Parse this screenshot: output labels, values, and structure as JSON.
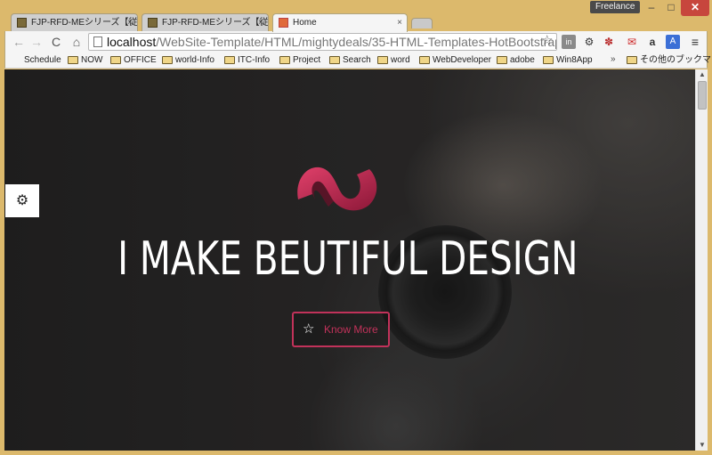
{
  "window": {
    "profile_label": "Freelance",
    "minimize_glyph": "–",
    "maximize_glyph": "□",
    "close_glyph": "✕"
  },
  "tabs": [
    {
      "title": "FJP-RFD-MEシリーズ【従来",
      "close": "×"
    },
    {
      "title": "FJP-RFD-MEシリーズ【従来",
      "close": "×"
    },
    {
      "title": "Home",
      "close": "×"
    }
  ],
  "toolbar": {
    "back_glyph": "←",
    "forward_glyph": "→",
    "reload_glyph": "C",
    "home_glyph": "⌂",
    "url_host": "localhost",
    "url_path": "/WebSite-Template/HTML/mightydeals/35-HTML-Templates-HotBootstrap.",
    "star_glyph": "☆",
    "extensions": [
      {
        "icon": "ext-in-icon",
        "glyph": "in"
      },
      {
        "icon": "gear-icon",
        "glyph": "⚙"
      },
      {
        "icon": "puzzle-icon",
        "glyph": "✽"
      },
      {
        "icon": "translate-icon",
        "glyph": "✉"
      },
      {
        "icon": "amazon-icon",
        "glyph": "a"
      },
      {
        "icon": "google-translate-icon",
        "glyph": "A"
      },
      {
        "icon": "menu-icon",
        "glyph": "≡"
      }
    ]
  },
  "bookmarks": {
    "items": [
      {
        "label": "Schedule",
        "icon": "apple-icon"
      },
      {
        "label": "NOW",
        "icon": "folder-icon"
      },
      {
        "label": "OFFICE",
        "icon": "folder-icon"
      },
      {
        "label": "world-Info",
        "icon": "folder-icon"
      },
      {
        "label": "ITC-Info",
        "icon": "folder-icon"
      },
      {
        "label": "Project",
        "icon": "folder-icon"
      },
      {
        "label": "Search",
        "icon": "folder-icon"
      },
      {
        "label": "word",
        "icon": "folder-icon"
      },
      {
        "label": "WebDeveloper",
        "icon": "folder-icon"
      },
      {
        "label": "adobe",
        "icon": "folder-icon"
      },
      {
        "label": "Win8App",
        "icon": "folder-icon"
      }
    ],
    "more_glyph": "»",
    "other_label": "その他のブックマーク"
  },
  "page": {
    "settings_glyph": "⚙",
    "headline": "I MAKE BEUTIFUL DESIGN",
    "cta_label": "Know More",
    "cta_icon_glyph": "☆",
    "accent_color": "#c1325a"
  },
  "scrollbar": {
    "up_glyph": "▲",
    "down_glyph": "▼"
  }
}
